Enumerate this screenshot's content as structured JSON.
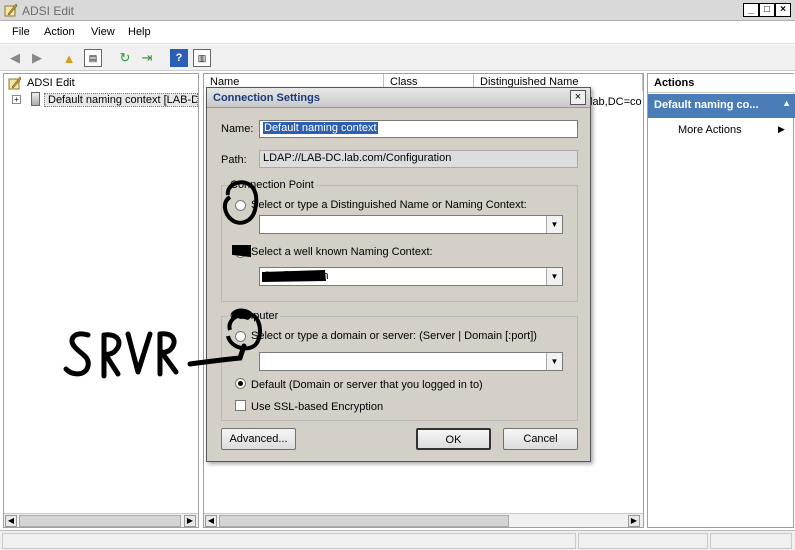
{
  "window": {
    "title": "ADSI Edit"
  },
  "menubar": {
    "items": [
      "File",
      "Action",
      "View",
      "Help"
    ]
  },
  "tree": {
    "root_label": "ADSI Edit",
    "child_label": "Default naming context [LAB-DC"
  },
  "list": {
    "columns": [
      "Name",
      "Class",
      "Distinguished Name"
    ],
    "partial_text": "lab,DC=co"
  },
  "actions": {
    "header": "Actions",
    "context": "Default naming co...",
    "more": "More Actions"
  },
  "dialog": {
    "title": "Connection Settings",
    "name_label": "Name:",
    "name_value": "Default naming context",
    "path_label": "Path:",
    "path_value": "LDAP://LAB-DC.lab.com/Configuration",
    "connection_point": {
      "legend": "Connection Point",
      "option_dn": "Select or type a Distinguished Name or Naming Context:",
      "dn_value": "",
      "option_known": "Select a well known Naming Context:",
      "known_value": "Configuration"
    },
    "computer": {
      "legend": "Computer",
      "option_server": "Select or type a domain or server: (Server | Domain [:port])",
      "server_value": "",
      "option_default": "Default (Domain or server that you logged in to)",
      "ssl_label": "Use SSL-based Encryption"
    },
    "advanced_label": "Advanced...",
    "ok_label": "OK",
    "cancel_label": "Cancel"
  },
  "annotation": {
    "text": "SRVR"
  },
  "colors": {
    "actions_highlight": "#4a7db8",
    "dialog_bg": "#d4d0c8",
    "ink": "#000000"
  }
}
